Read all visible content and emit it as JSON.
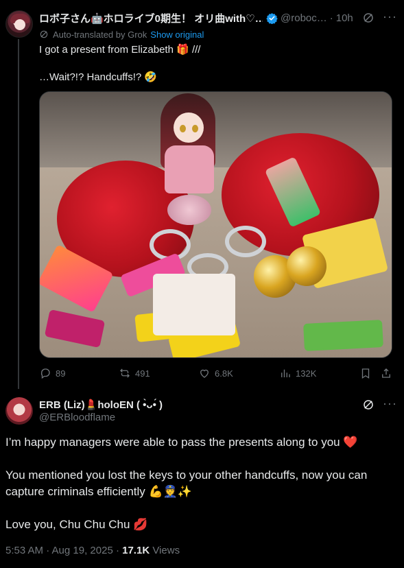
{
  "tweet": {
    "author_name": "ロボ子さん🤖ホロライブ0期生！ オリ曲with♡…",
    "handle": "@roboc…",
    "separator": "·",
    "time": "10h",
    "translate_note": "Auto-translated by Grok",
    "show_original": "Show original",
    "text_lines": [
      "I got a present from Elizabeth 🎁 ///",
      "…Wait?!? Handcuffs!? 🤣"
    ],
    "stats": {
      "replies": "89",
      "reposts": "491",
      "likes": "6.8K",
      "views": "132K"
    }
  },
  "reply": {
    "author_name": "ERB (Liz)💄holoEN ( •̀ᴗ•́ )",
    "handle": "@ERBloodflame",
    "paragraphs": [
      "I’m happy managers were able to pass the presents along to you ❤️",
      "You mentioned you lost the keys to your other handcuffs, now you can capture criminals efficiently 💪👮✨",
      "Love you, Chu Chu Chu 💋"
    ],
    "timestamp": "5:53 AM · Aug 19, 2025 ·",
    "view_count": "17.1K",
    "views_label": "Views"
  },
  "colors": {
    "background": "#000000",
    "text": "#e7e9ea",
    "muted": "#71767b",
    "accent": "#1d9bf0"
  },
  "icons": [
    "verified-badge-icon",
    "grok-icon",
    "more-icon",
    "translate-icon",
    "reply-icon",
    "repost-icon",
    "like-icon",
    "views-icon",
    "bookmark-icon",
    "share-icon"
  ]
}
